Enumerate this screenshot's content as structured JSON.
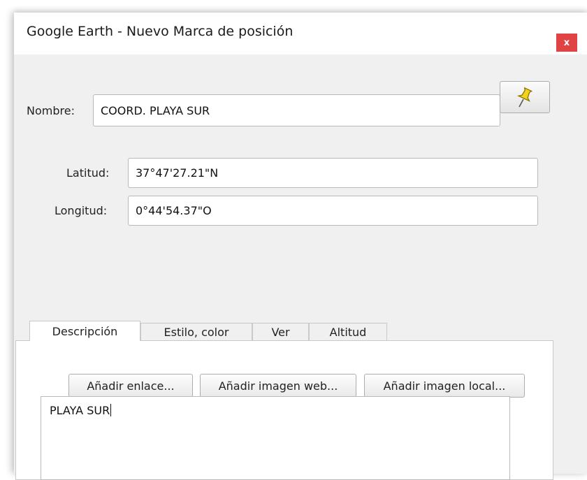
{
  "window": {
    "title": "Google Earth - Nuevo Marca de posición",
    "close_label": "x"
  },
  "form": {
    "name_label": "Nombre:",
    "name_value": "COORD. PLAYA SUR",
    "lat_label": "Latitud:",
    "lat_value": "37°47'27.21\"N",
    "lon_label": "Longitud:",
    "lon_value": "0°44'54.37\"O"
  },
  "icons": {
    "pin_button": "yellow-pushpin-icon",
    "close": "close-icon"
  },
  "tabs": [
    {
      "label": "Descripción",
      "active": true
    },
    {
      "label": "Estilo, color",
      "active": false
    },
    {
      "label": "Ver",
      "active": false
    },
    {
      "label": "Altitud",
      "active": false
    }
  ],
  "description": {
    "add_link_label": "Añadir enlace...",
    "add_web_image_label": "Añadir imagen web...",
    "add_local_image_label": "Añadir imagen local...",
    "text": "PLAYA SUR"
  },
  "colors": {
    "close_button": "#e04343",
    "window_bg": "#f0f0f0",
    "pin": "#f2d21b"
  }
}
